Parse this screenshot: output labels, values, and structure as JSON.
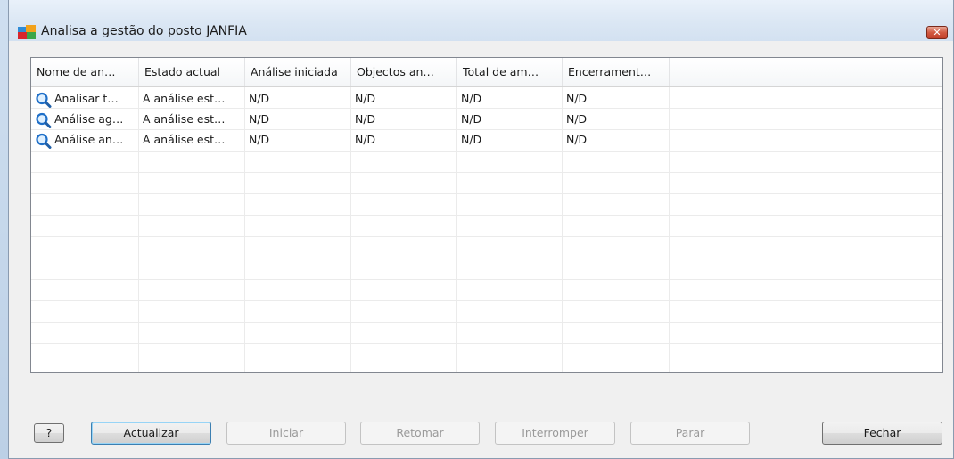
{
  "window": {
    "title": "Analisa a gestão do posto JANFIA",
    "close_label": "✕"
  },
  "table": {
    "columns": [
      "Nome de an…",
      "Estado actual",
      "Análise iniciada",
      "Objectos an…",
      "Total de am…",
      "Encerrament…"
    ],
    "rows": [
      [
        "Analisar t…",
        "A análise est…",
        "N/D",
        "N/D",
        "N/D",
        "N/D"
      ],
      [
        "Análise ag…",
        "A análise est…",
        "N/D",
        "N/D",
        "N/D",
        "N/D"
      ],
      [
        "Análise an…",
        "A análise est…",
        "N/D",
        "N/D",
        "N/D",
        "N/D"
      ]
    ],
    "row_icon": "magnifier-icon"
  },
  "buttons": {
    "help": "?",
    "refresh": "Actualizar",
    "start": "Iniciar",
    "resume": "Retomar",
    "interrupt": "Interromper",
    "stop": "Parar",
    "close": "Fechar"
  },
  "colors": {
    "accent": "#1f5fa8",
    "close_button": "#c74a33"
  }
}
